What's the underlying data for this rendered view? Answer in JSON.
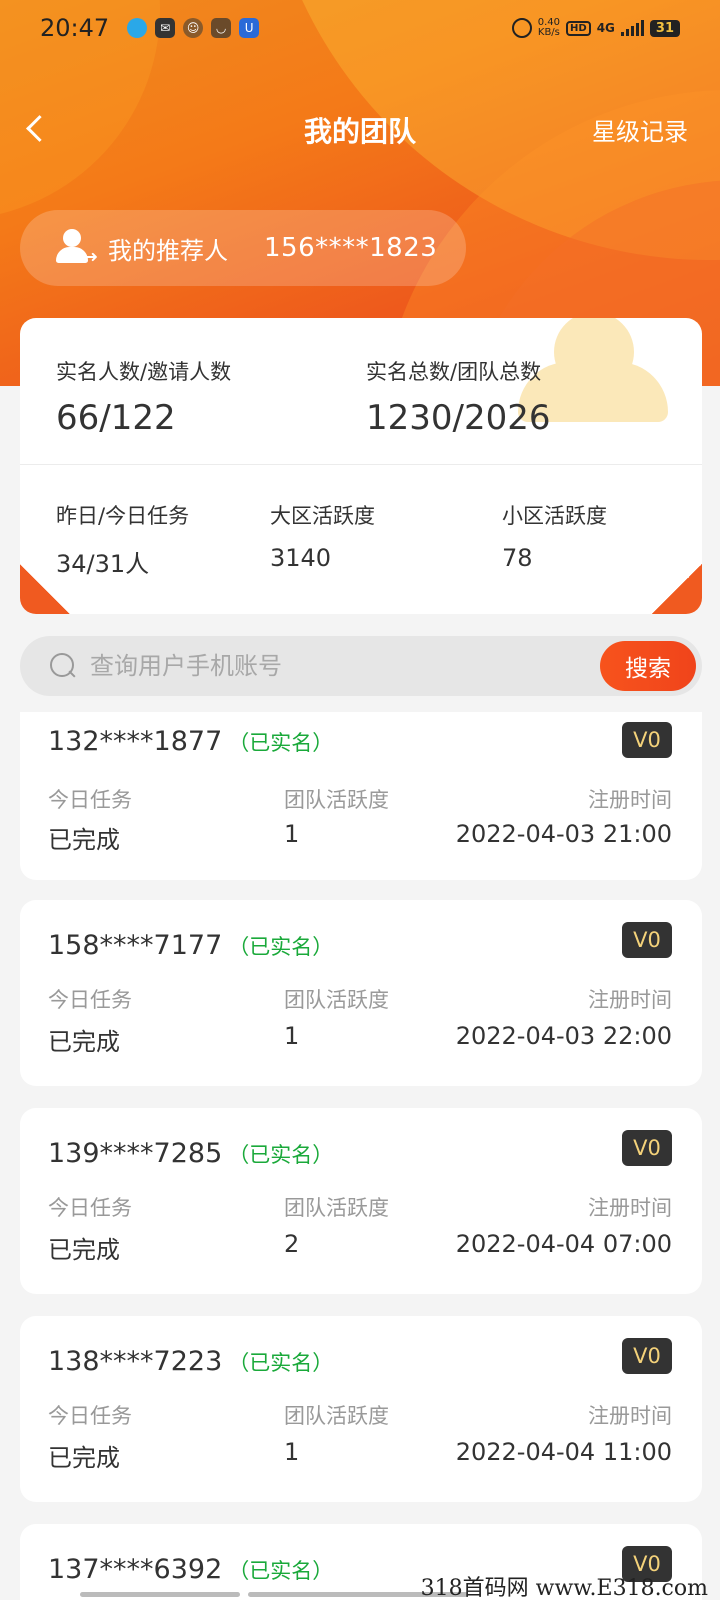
{
  "status_bar": {
    "time": "20:47",
    "speed": "0.40",
    "speed_unit": "KB/s",
    "network": "4G",
    "battery": "31"
  },
  "header": {
    "title": "我的团队",
    "right_action": "星级记录"
  },
  "referrer": {
    "label": "我的推荐人",
    "phone": "156****1823"
  },
  "stats": {
    "verified_invited_label": "实名人数/邀请人数",
    "verified_invited_value": "66/122",
    "total_label": "实名总数/团队总数",
    "total_value": "1230/2026",
    "tasks_label": "昨日/今日任务",
    "tasks_value": "34/31人",
    "big_area_label": "大区活跃度",
    "big_area_value": "3140",
    "small_area_label": "小区活跃度",
    "small_area_value": "78"
  },
  "search": {
    "placeholder": "查询用户手机账号",
    "button": "搜索"
  },
  "labels": {
    "task": "今日任务",
    "activity": "团队活跃度",
    "register": "注册时间"
  },
  "members": [
    {
      "phone": "132****1877",
      "status": "（已实名）",
      "level": "V0",
      "task": "已完成",
      "activity": "1",
      "time": "2022-04-03 21:00"
    },
    {
      "phone": "158****7177",
      "status": "（已实名）",
      "level": "V0",
      "task": "已完成",
      "activity": "1",
      "time": "2022-04-03 22:00"
    },
    {
      "phone": "139****7285",
      "status": "（已实名）",
      "level": "V0",
      "task": "已完成",
      "activity": "2",
      "time": "2022-04-04 07:00"
    },
    {
      "phone": "138****7223",
      "status": "（已实名）",
      "level": "V0",
      "task": "已完成",
      "activity": "1",
      "time": "2022-04-04 11:00"
    },
    {
      "phone": "137****6392",
      "status": "（已实名）",
      "level": "V0"
    }
  ],
  "watermark": "318首码网 www.E318.com",
  "colors": {
    "accent": "#f05a20",
    "verified_green": "#1aa93a",
    "level_badge_bg": "#333333",
    "level_badge_text": "#f4d27a"
  }
}
